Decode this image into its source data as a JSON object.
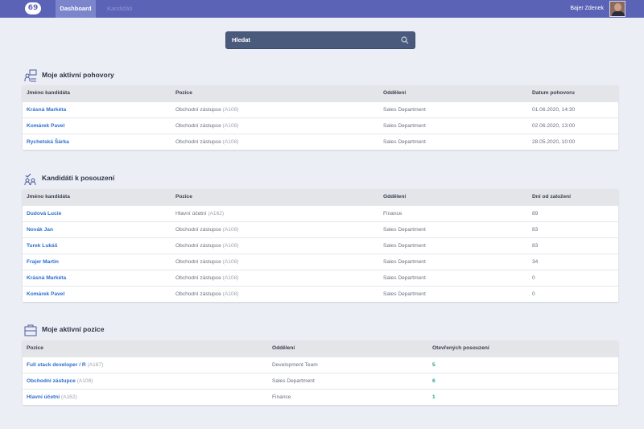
{
  "nav": {
    "logo": "69",
    "tabs": [
      "Dashboard",
      "Kandidáti"
    ],
    "user": "Bajer Zdenek"
  },
  "search": {
    "placeholder": "Hledat"
  },
  "interviews": {
    "title": "Moje aktivní pohovory",
    "headers": [
      "Jméno kandidáta",
      "Pozice",
      "Oddělení",
      "Datum pohovoru"
    ],
    "rows": [
      {
        "name": "Krásná Markéta",
        "position": "Obchodní zástupce",
        "code": "(A108)",
        "department": "Sales Department",
        "date": "01.06.2020, 14:30"
      },
      {
        "name": "Komárek Pavel",
        "position": "Obchodní zástupce",
        "code": "(A108)",
        "department": "Sales Department",
        "date": "02.06.2020, 13:00"
      },
      {
        "name": "Rychetská Šárka",
        "position": "Obchodní zástupce",
        "code": "(A108)",
        "department": "Sales Department",
        "date": "28.05.2020, 10:00"
      }
    ]
  },
  "candidates": {
    "title": "Kandidáti k posouzení",
    "headers": [
      "Jméno kandidáta",
      "Pozice",
      "Oddělení",
      "Dní od založení"
    ],
    "rows": [
      {
        "name": "Dudová Lucie",
        "position": "Hlavní účetní",
        "code": "(A162)",
        "department": "Finance",
        "days": "89"
      },
      {
        "name": "Novák Jan",
        "position": "Obchodní zástupce",
        "code": "(A108)",
        "department": "Sales Department",
        "days": "83"
      },
      {
        "name": "Turek Lukáš",
        "position": "Obchodní zástupce",
        "code": "(A108)",
        "department": "Sales Department",
        "days": "83"
      },
      {
        "name": "Frajer Martin",
        "position": "Obchodní zástupce",
        "code": "(A108)",
        "department": "Sales Department",
        "days": "34"
      },
      {
        "name": "Krásná Markéta",
        "position": "Obchodní zástupce",
        "code": "(A108)",
        "department": "Sales Department",
        "days": "0"
      },
      {
        "name": "Komárek Pavel",
        "position": "Obchodní zástupce",
        "code": "(A108)",
        "department": "Sales Department",
        "days": "0"
      }
    ]
  },
  "positions": {
    "title": "Moje aktivní pozice",
    "headers": [
      "Pozice",
      "Oddělení",
      "Otevřených posouzení"
    ],
    "rows": [
      {
        "position": "Full stack developer / R",
        "code": "(A187)",
        "department": "Development Team",
        "open": "5"
      },
      {
        "position": "Obchodní zástupce",
        "code": "(A108)",
        "department": "Sales Department",
        "open": "6"
      },
      {
        "position": "Hlavní účetní",
        "code": "(A162)",
        "department": "Finance",
        "open": "1"
      }
    ]
  },
  "colors": {
    "topbar": "#5b63b7",
    "link": "#2f6fcf",
    "accent": "#1fa38f"
  },
  "icons": {
    "interviews": "interview-icon",
    "candidates": "candidates-check-icon",
    "positions": "briefcase-icon",
    "search": "search-icon"
  }
}
